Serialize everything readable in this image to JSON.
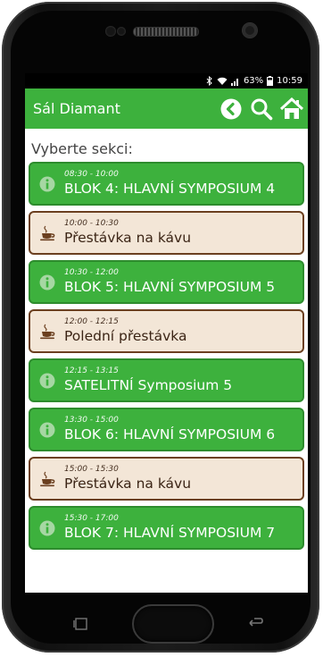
{
  "status_bar": {
    "bluetooth_icon": "bluetooth-icon",
    "wifi_icon": "wifi-icon",
    "signal_icon": "signal-icon",
    "battery_percent": "63%",
    "battery_icon": "battery-icon",
    "time": "10:59"
  },
  "app_bar": {
    "title": "Sál Diamant",
    "back_icon": "chevron-left-circle-icon",
    "search_icon": "search-icon",
    "home_icon": "home-icon"
  },
  "content": {
    "heading": "Vyberte sekci:",
    "items": [
      {
        "type": "session",
        "icon": "info-icon",
        "time": "08:30 - 10:00",
        "label": "BLOK 4: HLAVNÍ SYMPOSIUM 4"
      },
      {
        "type": "break",
        "icon": "coffee-cup-icon",
        "time": "10:00 - 10:30",
        "label": "Přestávka na kávu"
      },
      {
        "type": "session",
        "icon": "info-icon",
        "time": "10:30 - 12:00",
        "label": "BLOK 5: HLAVNÍ SYMPOSIUM 5"
      },
      {
        "type": "break",
        "icon": "coffee-cup-icon",
        "time": "12:00 - 12:15",
        "label": "Polední přestávka"
      },
      {
        "type": "session",
        "icon": "info-icon",
        "time": "12:15 - 13:15",
        "label": "SATELITNÍ Symposium 5"
      },
      {
        "type": "session",
        "icon": "info-icon",
        "time": "13:30 - 15:00",
        "label": "BLOK 6: HLAVNÍ SYMPOSIUM 6"
      },
      {
        "type": "break",
        "icon": "coffee-cup-icon",
        "time": "15:00 - 15:30",
        "label": "Přestávka na kávu"
      },
      {
        "type": "session",
        "icon": "info-icon",
        "time": "15:30 - 17:00",
        "label": "BLOK 7: HLAVNÍ SYMPOSIUM 7"
      }
    ]
  },
  "colors": {
    "accent_green": "#3db13d",
    "break_background": "#f3e6d7",
    "break_border": "#6b3f1f"
  }
}
